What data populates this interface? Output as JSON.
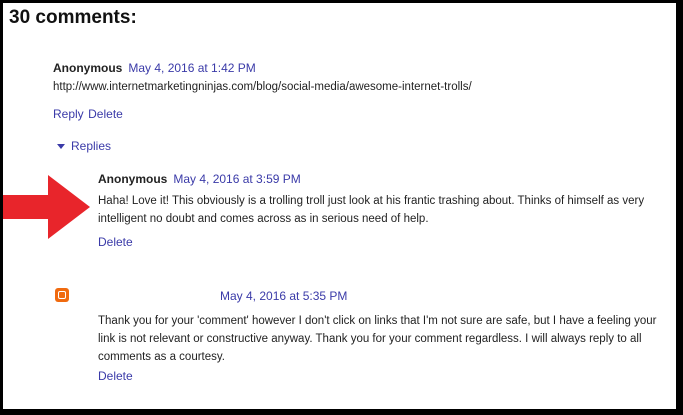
{
  "comments_heading": "30 comments:",
  "comment1": {
    "author": "Anonymous",
    "timestamp": "May 4, 2016 at 1:42 PM",
    "text": "http://www.internetmarketingninjas.com/blog/social-media/awesome-internet-trolls/",
    "reply_label": "Reply",
    "delete_label": "Delete"
  },
  "replies_toggle": {
    "label": "Replies",
    "icon": "chevron-down-icon"
  },
  "reply1": {
    "author": "Anonymous",
    "timestamp": "May 4, 2016 at 3:59 PM",
    "text": "Haha! Love it! This obviously is a trolling troll just look at his frantic trashing about. Thinks of himself as very intelligent no doubt and comes across as in serious need of help.",
    "delete_label": "Delete"
  },
  "reply2": {
    "avatar_icon": "blogger-icon",
    "timestamp": "May 4, 2016 at 5:35 PM",
    "text": "Thank you for your 'comment' however I don't click on links that I'm not sure are safe, but I have a feeling your link is not relevant or constructive anyway. Thank you for your comment regardless. I will always reply to all comments as a courtesy.",
    "delete_label": "Delete"
  },
  "annotation": {
    "icon": "red-arrow-icon",
    "color": "#e8252b"
  },
  "colors": {
    "link": "#3a3aa8",
    "text": "#222222",
    "blogger_orange": "#f06a0f"
  }
}
